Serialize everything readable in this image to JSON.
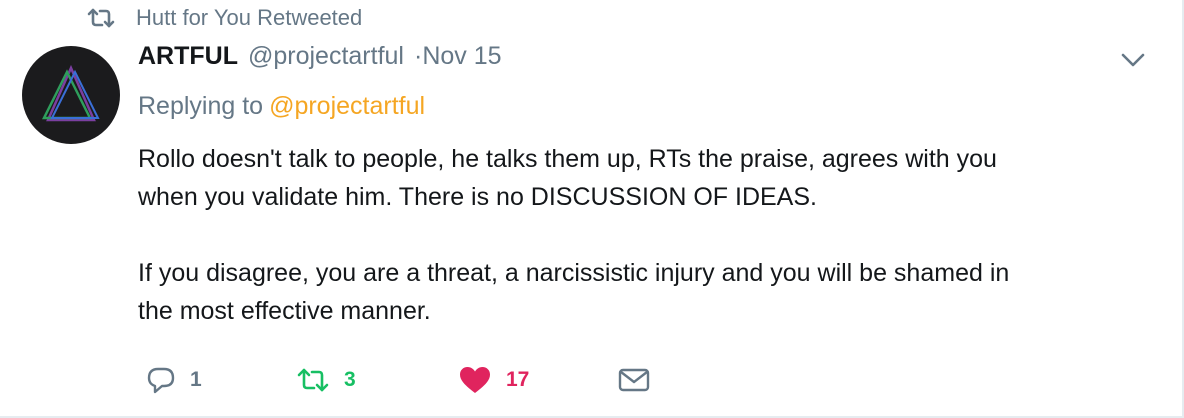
{
  "context": {
    "label": "Hutt for You Retweeted",
    "icon": "retweet-icon"
  },
  "author": {
    "name": "ARTFUL",
    "handle": "@projectartful",
    "separator": "·",
    "time": "Nov 15",
    "avatar_icon": "triangle-logo-icon"
  },
  "reply": {
    "prefix": "Replying to",
    "mention": "@projectartful"
  },
  "text": {
    "paragraph1": "Rollo doesn't talk to people, he talks them up, RTs the praise, agrees with you\nwhen you validate him. There is no DISCUSSION OF IDEAS.",
    "paragraph2": "If you disagree, you are a threat, a narcissistic injury and you will be shamed in\nthe most effective manner."
  },
  "actions": {
    "reply_count": "1",
    "retweet_count": "3",
    "like_count": "17",
    "icons": [
      "reply-icon",
      "retweet-icon",
      "heart-icon",
      "envelope-icon"
    ]
  },
  "colors": {
    "muted": "#657786",
    "mention": "#f5a623",
    "retweet_active": "#17bf63",
    "like_active": "#e0245e"
  }
}
